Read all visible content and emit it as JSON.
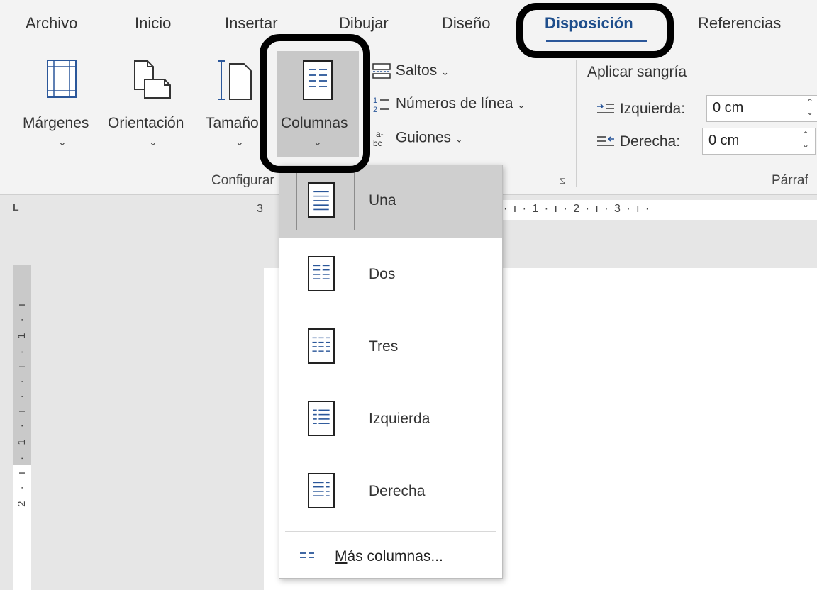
{
  "tabs": [
    "Archivo",
    "Inicio",
    "Insertar",
    "Dibujar",
    "Diseño",
    "Disposición",
    "Referencias"
  ],
  "page_setup": {
    "margins_label": "Márgenes",
    "orientation_label": "Orientación",
    "size_label": "Tamaño",
    "columns_label": "Columnas",
    "breaks_label": "Saltos",
    "line_numbers_label": "Números de línea",
    "hyphenation_label": "Guiones",
    "group_label": "Configurar"
  },
  "paragraph": {
    "indent_title": "Aplicar sangría",
    "left_label": "Izquierda:",
    "left_value": "0 cm",
    "right_label": "Derecha:",
    "right_value": "0 cm",
    "group_label": "Párraf"
  },
  "ruler": {
    "corner_mark": "L",
    "left_number": "3",
    "ticks": "· ı · 1 · ı · 2 · ı · 3 · ı ·",
    "vertical_ticks": "2 · ı · 1 · ı · · ı · 1 · ı"
  },
  "columns_menu": {
    "items": [
      "Una",
      "Dos",
      "Tres",
      "Izquierda",
      "Derecha"
    ],
    "selected": "Una",
    "more_prefix": "M",
    "more_rest": "ás columnas..."
  },
  "accent_color": "#2b579a",
  "icon_names": [
    "margins-icon",
    "orientation-icon",
    "size-icon",
    "columns-icon",
    "breaks-icon",
    "line-numbers-icon",
    "hyphenation-icon",
    "indent-left-icon",
    "indent-right-icon"
  ]
}
